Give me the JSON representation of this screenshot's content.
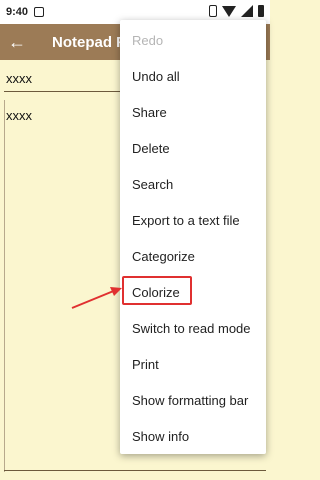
{
  "status_bar": {
    "time": "9:40"
  },
  "app_bar": {
    "title": "Notepad F",
    "back_icon": "arrow-back-icon"
  },
  "note": {
    "title": "xxxx",
    "body": "xxxx"
  },
  "menu": {
    "items": [
      {
        "label": "Redo",
        "enabled": false
      },
      {
        "label": "Undo all",
        "enabled": true
      },
      {
        "label": "Share",
        "enabled": true
      },
      {
        "label": "Delete",
        "enabled": true
      },
      {
        "label": "Search",
        "enabled": true
      },
      {
        "label": "Export to a text file",
        "enabled": true
      },
      {
        "label": "Categorize",
        "enabled": true
      },
      {
        "label": "Colorize",
        "enabled": true
      },
      {
        "label": "Switch to read mode",
        "enabled": true
      },
      {
        "label": "Print",
        "enabled": true
      },
      {
        "label": "Show formatting bar",
        "enabled": true
      },
      {
        "label": "Show info",
        "enabled": true
      }
    ]
  },
  "colors": {
    "app_bar": "#9c7b56",
    "note_bg": "#fbf6cf",
    "annotation": "#e03030"
  }
}
